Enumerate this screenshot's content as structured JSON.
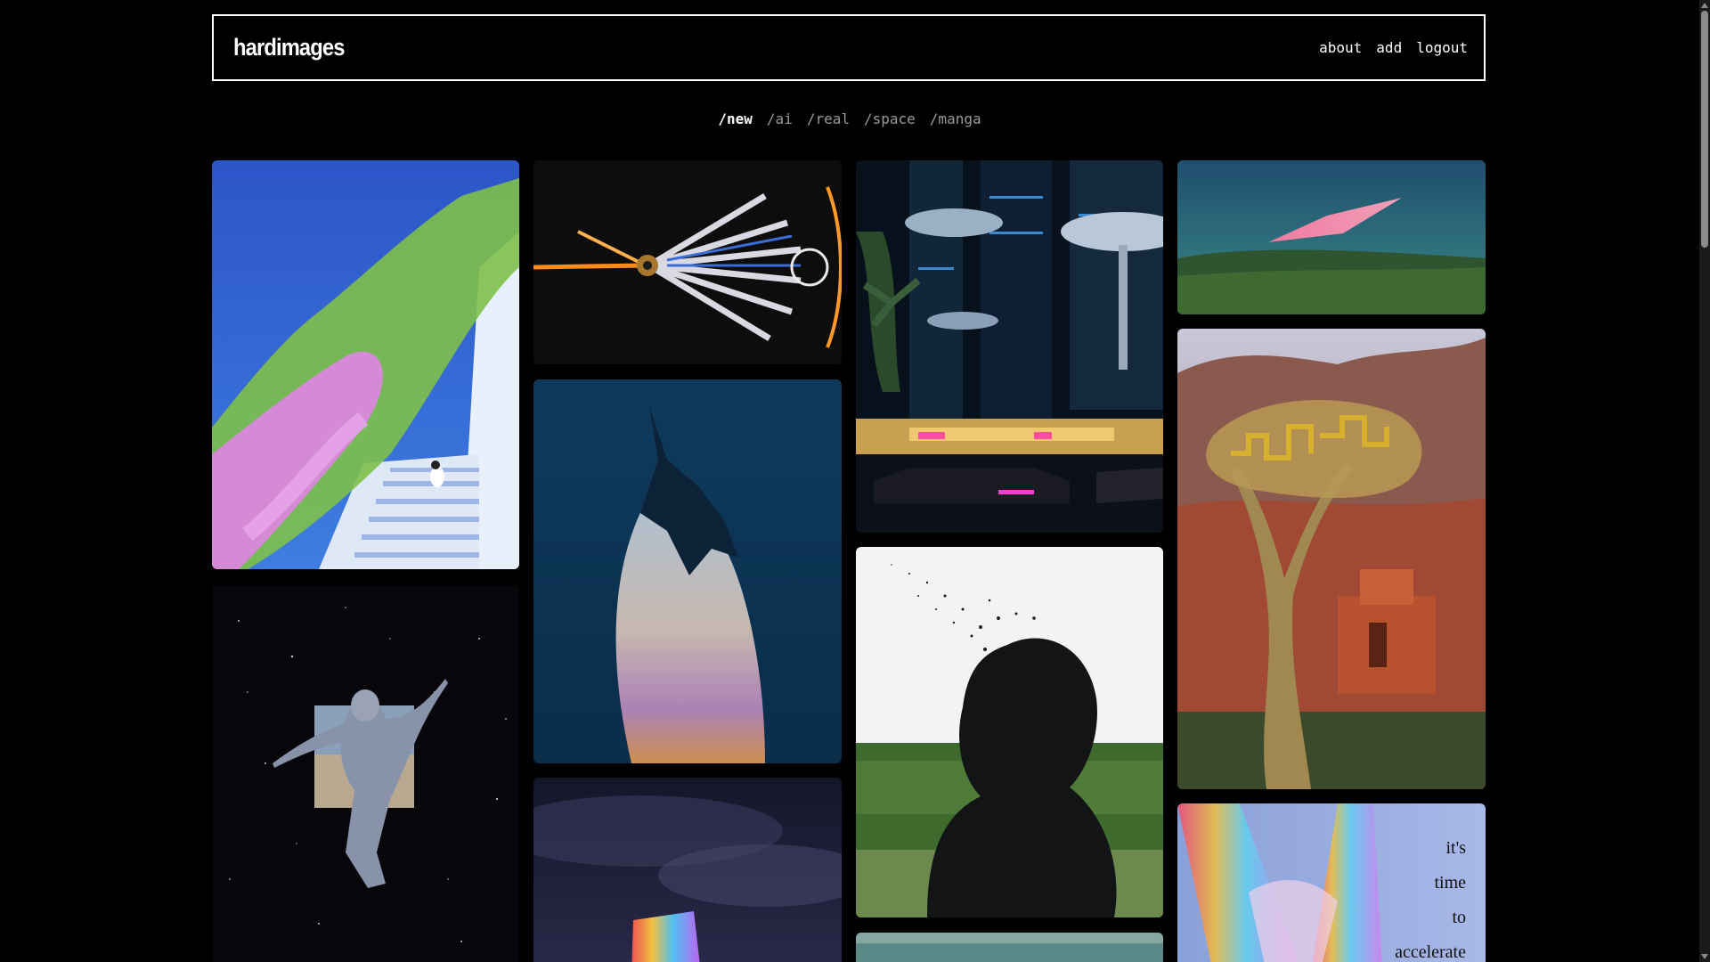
{
  "header": {
    "brand": "hardimages",
    "nav": [
      "about",
      "add",
      "logout"
    ]
  },
  "tabs": [
    {
      "label": "/new",
      "active": true
    },
    {
      "label": "/ai",
      "active": false
    },
    {
      "label": "/real",
      "active": false
    },
    {
      "label": "/space",
      "active": false
    },
    {
      "label": "/manga",
      "active": false
    }
  ],
  "tiles": {
    "quote_lines": [
      "it's",
      "time",
      "to",
      "accelerate"
    ]
  }
}
